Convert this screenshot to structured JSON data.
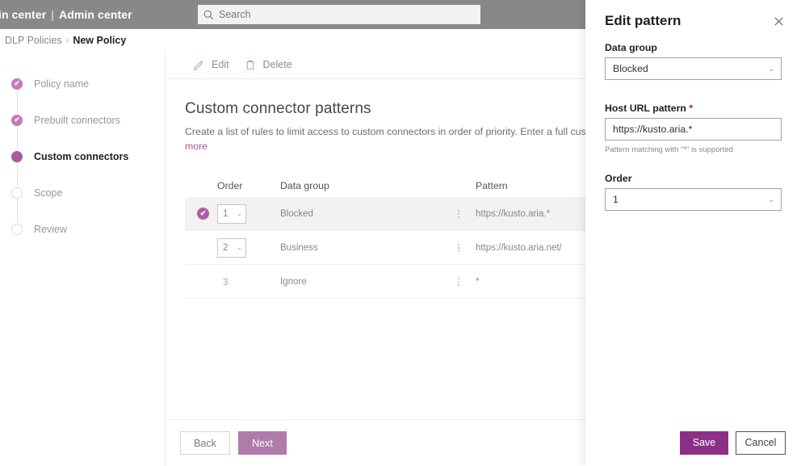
{
  "suite": {
    "brand_left": "in center",
    "brand_divider": "|",
    "brand_right": "Admin center",
    "search_placeholder": "Search",
    "search_value": "",
    "search_icon": "search-icon",
    "bar_color": "#8a8886"
  },
  "breadcrumb": {
    "parent": "DLP Policies",
    "separator": "›",
    "current": "New Policy"
  },
  "wizard": {
    "steps": [
      {
        "label": "Policy name",
        "state": "done"
      },
      {
        "label": "Prebuilt connectors",
        "state": "done"
      },
      {
        "label": "Custom connectors",
        "state": "active"
      },
      {
        "label": "Scope",
        "state": "todo"
      },
      {
        "label": "Review",
        "state": "todo"
      }
    ],
    "check_glyph": "✔"
  },
  "command_bar": {
    "edit_label": "Edit",
    "edit_icon": "pencil-icon",
    "delete_label": "Delete",
    "delete_icon": "trash-icon"
  },
  "section": {
    "title": "Custom connector patterns",
    "description": "Create a list of rules to limit access to custom connectors in order of priority. Enter a full custom connector U",
    "more_link": "more"
  },
  "table": {
    "headers": {
      "order": "Order",
      "data_group": "Data group",
      "pattern": "Pattern"
    },
    "rows": [
      {
        "selected": true,
        "order": "1",
        "order_is_select": true,
        "data_group": "Blocked",
        "pattern": "https://kusto.aria.*"
      },
      {
        "selected": false,
        "order": "2",
        "order_is_select": true,
        "data_group": "Business",
        "pattern": "https://kusto.aria.net/"
      },
      {
        "selected": false,
        "order": "3",
        "order_is_select": false,
        "data_group": "Ignore",
        "pattern": "*"
      }
    ],
    "kebab_icon": "more-vertical-icon",
    "caret_glyph": "⌄",
    "check_glyph": "✔"
  },
  "footer": {
    "back_label": "Back",
    "next_label": "Next"
  },
  "panel": {
    "title": "Edit pattern",
    "close_icon": "close-icon",
    "data_group_label": "Data group",
    "data_group_value": "Blocked",
    "host_url_label": "Host URL pattern",
    "required_marker": "*",
    "host_url_value": "https://kusto.aria.*",
    "host_url_placeholder": "https://",
    "hint": "Pattern matching with \"*\" is supported",
    "order_label": "Order",
    "order_value": "1",
    "save_label": "Save",
    "cancel_label": "Cancel",
    "caret_glyph": "⌄"
  },
  "colors": {
    "accent_purple": "#8c2f87",
    "accent_light": "#a85ca0",
    "header_gray": "#8a8886",
    "required_red": "#a4262c",
    "selected_row": "#f3f2f1"
  }
}
